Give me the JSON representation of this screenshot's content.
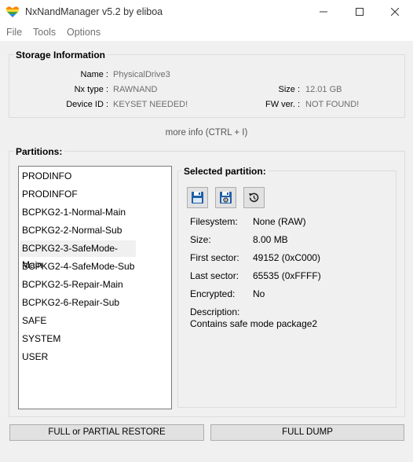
{
  "window": {
    "title": "NxNandManager v5.2 by eliboa"
  },
  "menu": {
    "file": "File",
    "tools": "Tools",
    "options": "Options"
  },
  "storage": {
    "title": "Storage Information",
    "name_label": "Name :",
    "name_value": "PhysicalDrive3",
    "nxtype_label": "Nx type :",
    "nxtype_value": "RAWNAND",
    "deviceid_label": "Device ID :",
    "deviceid_value": "KEYSET NEEDED!",
    "size_label": "Size :",
    "size_value": "12.01 GB",
    "fwver_label": "FW ver. :",
    "fwver_value": "NOT FOUND!",
    "more_info": "more info (CTRL + I)"
  },
  "partitions": {
    "title": "Partitions:",
    "items": [
      "PRODINFO",
      "PRODINFOF",
      "BCPKG2-1-Normal-Main",
      "BCPKG2-2-Normal-Sub",
      "BCPKG2-3-SafeMode-Main",
      "BCPKG2-4-SafeMode-Sub",
      "BCPKG2-5-Repair-Main",
      "BCPKG2-6-Repair-Sub",
      "SAFE",
      "SYSTEM",
      "USER"
    ],
    "selected_index": 4
  },
  "selected": {
    "title": "Selected partition:",
    "filesystem_label": "Filesystem:",
    "filesystem_value": "None (RAW)",
    "size_label": "Size:",
    "size_value": "8.00 MB",
    "first_label": "First sector:",
    "first_value": "49152 (0xC000)",
    "last_label": "Last sector:",
    "last_value": "65535 (0xFFFF)",
    "encrypted_label": "Encrypted:",
    "encrypted_value": "No",
    "description_label": "Description:",
    "description_value": "Contains safe mode package2"
  },
  "buttons": {
    "restore": "FULL or PARTIAL RESTORE",
    "dump": "FULL DUMP"
  },
  "icons": {
    "app": "rainbow-heart-icon",
    "dump": "save-icon",
    "advanced_dump": "save-gear-icon",
    "restore": "restore-icon"
  },
  "colors": {
    "accent": "#1e5fa8",
    "value_gray": "#6d6d6d"
  }
}
